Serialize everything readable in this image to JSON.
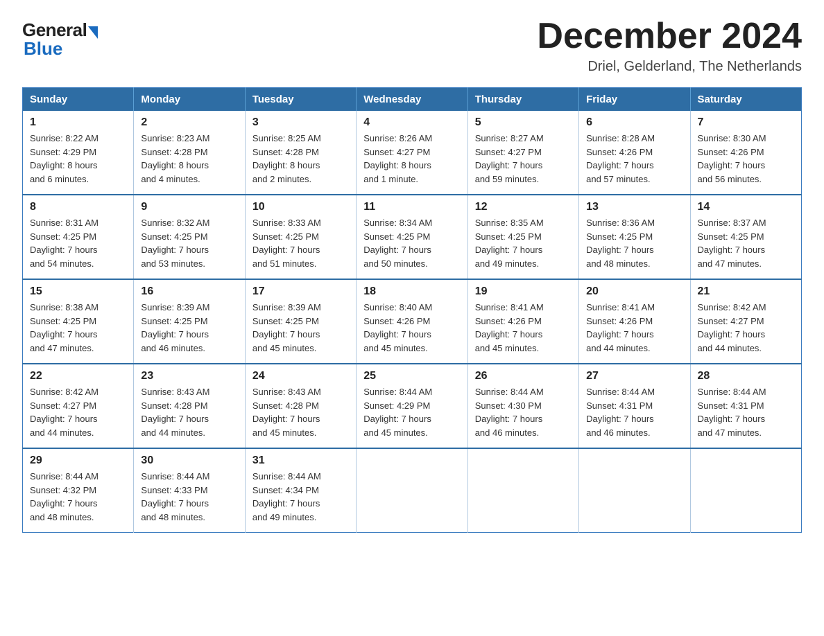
{
  "logo": {
    "general": "General",
    "blue": "Blue",
    "arrow_color": "#1a6bbf"
  },
  "header": {
    "month_title": "December 2024",
    "location": "Driel, Gelderland, The Netherlands"
  },
  "weekdays": [
    "Sunday",
    "Monday",
    "Tuesday",
    "Wednesday",
    "Thursday",
    "Friday",
    "Saturday"
  ],
  "weeks": [
    [
      {
        "num": "1",
        "info": "Sunrise: 8:22 AM\nSunset: 4:29 PM\nDaylight: 8 hours\nand 6 minutes."
      },
      {
        "num": "2",
        "info": "Sunrise: 8:23 AM\nSunset: 4:28 PM\nDaylight: 8 hours\nand 4 minutes."
      },
      {
        "num": "3",
        "info": "Sunrise: 8:25 AM\nSunset: 4:28 PM\nDaylight: 8 hours\nand 2 minutes."
      },
      {
        "num": "4",
        "info": "Sunrise: 8:26 AM\nSunset: 4:27 PM\nDaylight: 8 hours\nand 1 minute."
      },
      {
        "num": "5",
        "info": "Sunrise: 8:27 AM\nSunset: 4:27 PM\nDaylight: 7 hours\nand 59 minutes."
      },
      {
        "num": "6",
        "info": "Sunrise: 8:28 AM\nSunset: 4:26 PM\nDaylight: 7 hours\nand 57 minutes."
      },
      {
        "num": "7",
        "info": "Sunrise: 8:30 AM\nSunset: 4:26 PM\nDaylight: 7 hours\nand 56 minutes."
      }
    ],
    [
      {
        "num": "8",
        "info": "Sunrise: 8:31 AM\nSunset: 4:25 PM\nDaylight: 7 hours\nand 54 minutes."
      },
      {
        "num": "9",
        "info": "Sunrise: 8:32 AM\nSunset: 4:25 PM\nDaylight: 7 hours\nand 53 minutes."
      },
      {
        "num": "10",
        "info": "Sunrise: 8:33 AM\nSunset: 4:25 PM\nDaylight: 7 hours\nand 51 minutes."
      },
      {
        "num": "11",
        "info": "Sunrise: 8:34 AM\nSunset: 4:25 PM\nDaylight: 7 hours\nand 50 minutes."
      },
      {
        "num": "12",
        "info": "Sunrise: 8:35 AM\nSunset: 4:25 PM\nDaylight: 7 hours\nand 49 minutes."
      },
      {
        "num": "13",
        "info": "Sunrise: 8:36 AM\nSunset: 4:25 PM\nDaylight: 7 hours\nand 48 minutes."
      },
      {
        "num": "14",
        "info": "Sunrise: 8:37 AM\nSunset: 4:25 PM\nDaylight: 7 hours\nand 47 minutes."
      }
    ],
    [
      {
        "num": "15",
        "info": "Sunrise: 8:38 AM\nSunset: 4:25 PM\nDaylight: 7 hours\nand 47 minutes."
      },
      {
        "num": "16",
        "info": "Sunrise: 8:39 AM\nSunset: 4:25 PM\nDaylight: 7 hours\nand 46 minutes."
      },
      {
        "num": "17",
        "info": "Sunrise: 8:39 AM\nSunset: 4:25 PM\nDaylight: 7 hours\nand 45 minutes."
      },
      {
        "num": "18",
        "info": "Sunrise: 8:40 AM\nSunset: 4:26 PM\nDaylight: 7 hours\nand 45 minutes."
      },
      {
        "num": "19",
        "info": "Sunrise: 8:41 AM\nSunset: 4:26 PM\nDaylight: 7 hours\nand 45 minutes."
      },
      {
        "num": "20",
        "info": "Sunrise: 8:41 AM\nSunset: 4:26 PM\nDaylight: 7 hours\nand 44 minutes."
      },
      {
        "num": "21",
        "info": "Sunrise: 8:42 AM\nSunset: 4:27 PM\nDaylight: 7 hours\nand 44 minutes."
      }
    ],
    [
      {
        "num": "22",
        "info": "Sunrise: 8:42 AM\nSunset: 4:27 PM\nDaylight: 7 hours\nand 44 minutes."
      },
      {
        "num": "23",
        "info": "Sunrise: 8:43 AM\nSunset: 4:28 PM\nDaylight: 7 hours\nand 44 minutes."
      },
      {
        "num": "24",
        "info": "Sunrise: 8:43 AM\nSunset: 4:28 PM\nDaylight: 7 hours\nand 45 minutes."
      },
      {
        "num": "25",
        "info": "Sunrise: 8:44 AM\nSunset: 4:29 PM\nDaylight: 7 hours\nand 45 minutes."
      },
      {
        "num": "26",
        "info": "Sunrise: 8:44 AM\nSunset: 4:30 PM\nDaylight: 7 hours\nand 46 minutes."
      },
      {
        "num": "27",
        "info": "Sunrise: 8:44 AM\nSunset: 4:31 PM\nDaylight: 7 hours\nand 46 minutes."
      },
      {
        "num": "28",
        "info": "Sunrise: 8:44 AM\nSunset: 4:31 PM\nDaylight: 7 hours\nand 47 minutes."
      }
    ],
    [
      {
        "num": "29",
        "info": "Sunrise: 8:44 AM\nSunset: 4:32 PM\nDaylight: 7 hours\nand 48 minutes."
      },
      {
        "num": "30",
        "info": "Sunrise: 8:44 AM\nSunset: 4:33 PM\nDaylight: 7 hours\nand 48 minutes."
      },
      {
        "num": "31",
        "info": "Sunrise: 8:44 AM\nSunset: 4:34 PM\nDaylight: 7 hours\nand 49 minutes."
      },
      {
        "num": "",
        "info": ""
      },
      {
        "num": "",
        "info": ""
      },
      {
        "num": "",
        "info": ""
      },
      {
        "num": "",
        "info": ""
      }
    ]
  ]
}
